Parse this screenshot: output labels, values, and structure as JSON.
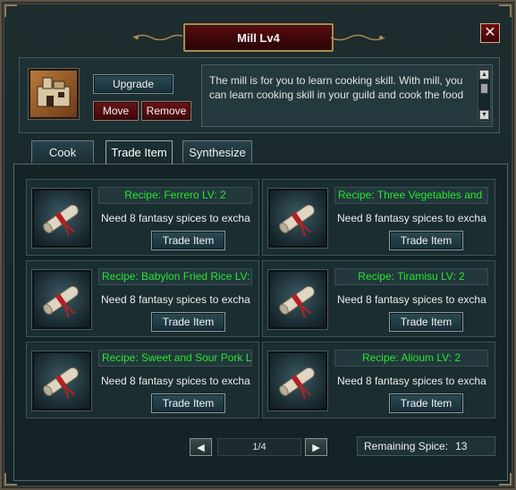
{
  "window": {
    "title": "Mill Lv4",
    "close_label": "✕"
  },
  "header": {
    "building_icon": "mill-building-icon",
    "upgrade_label": "Upgrade",
    "move_label": "Move",
    "remove_label": "Remove",
    "description_line1": "The mill is for you to learn cooking skill. With mill, you",
    "description_line2": "can learn cooking skill in your guild and cook the food"
  },
  "tabs": [
    {
      "label": "Cook",
      "active": false
    },
    {
      "label": "Trade Item",
      "active": true
    },
    {
      "label": "Synthesize",
      "active": false
    }
  ],
  "recipes": [
    {
      "name": "Recipe: Ferrero LV: 2",
      "requirement": "Need 8 fantasy spices to excha",
      "button": "Trade Item",
      "icon": "recipe-scroll-icon"
    },
    {
      "name": "Recipe: Three Vegetables and",
      "requirement": "Need 8 fantasy spices to excha",
      "button": "Trade Item",
      "icon": "recipe-scroll-icon"
    },
    {
      "name": "Recipe: Babylon Fried Rice LV:",
      "requirement": "Need 8 fantasy spices to excha",
      "button": "Trade Item",
      "icon": "recipe-scroll-icon"
    },
    {
      "name": "Recipe: Tiramisu LV: 2",
      "requirement": "Need 8 fantasy spices to excha",
      "button": "Trade Item",
      "icon": "recipe-scroll-icon"
    },
    {
      "name": "Recipe: Sweet and Sour Pork L",
      "requirement": "Need 8 fantasy spices to excha",
      "button": "Trade Item",
      "icon": "recipe-scroll-icon"
    },
    {
      "name": "Recipe: Alioum LV: 2",
      "requirement": "Need 8 fantasy spices to excha",
      "button": "Trade Item",
      "icon": "recipe-scroll-icon"
    }
  ],
  "pagination": {
    "prev_label": "◀",
    "page_text": "1/4",
    "next_label": "▶"
  },
  "spice": {
    "label": "Remaining Spice:",
    "value": "13"
  },
  "colors": {
    "recipe_name": "#27e52f",
    "title_plate": "#4a0b0e",
    "panel_bg": "#17292c"
  }
}
